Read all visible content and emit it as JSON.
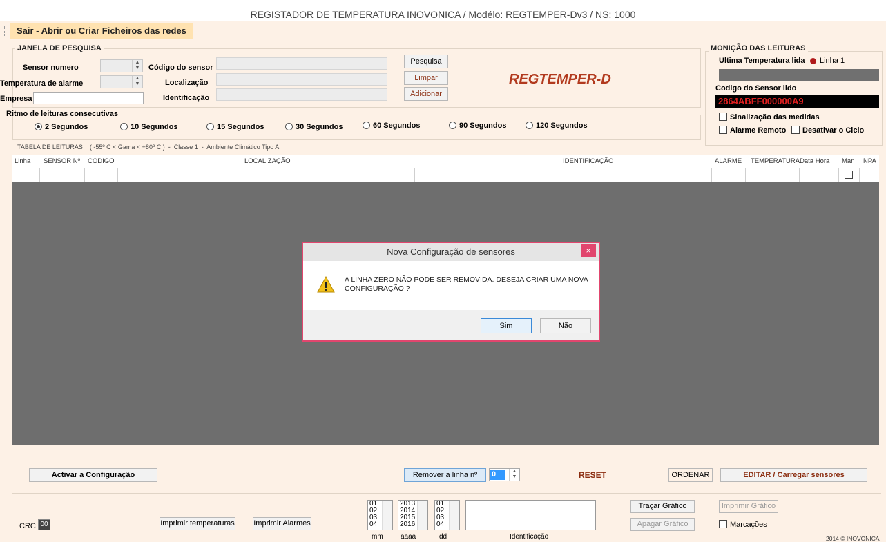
{
  "window": {
    "title": "REGISTADOR DE TEMPERATURA  INOVONICA  / Modélo: REGTEMPER-Dv3   / NS: 1000"
  },
  "menu": {
    "item": "Sair - Abrir ou Criar Ficheiros das redes"
  },
  "search": {
    "legend": "JANELA DE PESQUISA",
    "sensor_numero_label": "Sensor numero",
    "temp_alarme_label": "Temperatura de alarme",
    "empresa_label": "Empresa",
    "codigo_label": "Código do sensor",
    "localizacao_label": "Localização",
    "identificacao_label": "Identificação",
    "pesquisa_button": "Pesquisa",
    "limpar_button": "Limpar",
    "adicionar_button": "Adicionar",
    "brand": "REGTEMPER-D"
  },
  "rhythm": {
    "legend": "Ritmo de leituras consecutivas",
    "options": [
      "2 Segundos",
      "10 Segundos",
      "15 Segundos",
      "30 Segundos",
      "60 Segundos",
      "90 Segundos",
      "120 Segundos"
    ],
    "selected": "2 Segundos"
  },
  "monitor": {
    "legend": "MONIÇÃO DAS LEITURAS",
    "ultima_label": "Ultima Temperatura lida",
    "linha_label": "Linha 1",
    "codigo_label": "Codigo do Sensor lido",
    "codigo_value": "2864ABFF000000A9",
    "sinalizacao_label": "Sinalização das medidas",
    "alarme_remoto_label": "Alarme Remoto",
    "desativar_label": "Desativar o Ciclo"
  },
  "table": {
    "legend": "TABELA DE LEITURAS    ( -55º C < Gama < +80º C )  -  Classe 1  -  Ambiente Climático Tipo A",
    "columns": [
      "Linha",
      "SENSOR Nº",
      "CODIGO",
      "LOCALIZAÇÃO",
      "IDENTIFICAÇÃO",
      "ALARME",
      "TEMPERATURA",
      "Data Hora",
      "Man",
      "NPA"
    ]
  },
  "dialog": {
    "title": "Nova Configuração de sensores",
    "close": "×",
    "message_line1": "A LINHA ZERO NÃO PODE SER REMOVIDA. DESEJA CRIAR UMA NOVA",
    "message_line2": "CONFIGURAÇÃO ?",
    "yes": "Sim",
    "no": "Não"
  },
  "actions": {
    "activar": "Activar a Configuração",
    "remover": "Remover a linha nº",
    "remover_value": "0",
    "reset": "RESET",
    "ordenar": "ORDENAR",
    "editar": "EDITAR / Carregar sensores"
  },
  "footer": {
    "crc_label": "CRC",
    "crc_value": "00",
    "imprimir_temp": "Imprimir temperaturas",
    "imprimir_alarmes": "Imprimir Alarmes",
    "mm_items": [
      "01",
      "02",
      "03",
      "04"
    ],
    "aaaa_items": [
      "2013",
      "2014",
      "2015",
      "2016"
    ],
    "dd_items": [
      "01",
      "02",
      "03",
      "04"
    ],
    "mm_label": "mm",
    "aaaa_label": "aaaa",
    "dd_label": "dd",
    "ident_label": "Identificação",
    "tracar": "Traçar Gráfico",
    "apagar": "Apagar Gráfico",
    "imprimir_grafico": "Imprimir Gráfico",
    "marcacoes": "Marcações",
    "copyright": "2014 © INOVONICA"
  }
}
